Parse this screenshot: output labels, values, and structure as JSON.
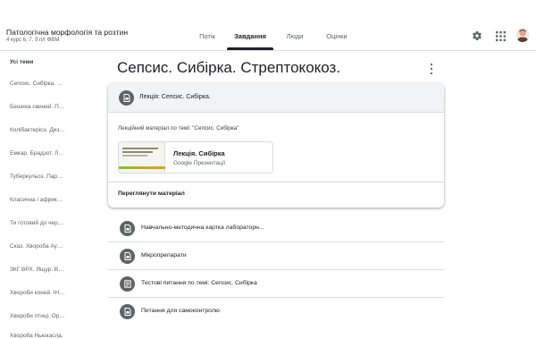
{
  "course": {
    "title": "Патологічна морфологія та розтин",
    "subtitle": "4 курс 6, 7, 9 п/г ФВМ"
  },
  "tabs": [
    {
      "label": "Потік",
      "active": false
    },
    {
      "label": "Завдання",
      "active": true
    },
    {
      "label": "Люди",
      "active": false
    },
    {
      "label": "Оцінки",
      "active": false
    }
  ],
  "header_icons": [
    "gear-icon",
    "apps-grid-icon",
    "avatar"
  ],
  "sidebar": {
    "heading": "Усі теми",
    "items": [
      "Сепсис. Сибірка. Стрептококоз.",
      "Бешиха свиней. Пастерельоз.",
      "Колібактеріоз. Дизентерія свиней.",
      "Емкар. Брадзот. Лептоспіроз.",
      "Туберкульоз. Паратуберкульоз.",
      "Класична і африканська чума свиней.",
      "Ти готовий до чергового заняття?",
      "Сказ. Хвороба Ауєскі.",
      "ЗКГ ВРХ. Ящур. Віспа.",
      "Хвороби коней. ІНАН.",
      "Хвороби птиці. Орнітоз.",
      "Хвороба Ньюкасла."
    ]
  },
  "topic": {
    "title": "Сепсис. Сибірка. Стрептококоз."
  },
  "expanded_card": {
    "title": "Лекція: Сепсис. Сибірка.",
    "description": "Лекційний матеріал по темі: \"Сепсис. Сибірка\"",
    "attachment": {
      "title": "Лекція. Сибірка",
      "type": "Google Презентації"
    },
    "view_label": "Переглянути матеріал"
  },
  "items": [
    {
      "label": "Навчально-методична картка лабораторн...",
      "icon": "material-icon"
    },
    {
      "label": "Мікропрепарати",
      "icon": "material-icon"
    },
    {
      "label": "Тестові питання по темі: Сепсис. Сибірка",
      "icon": "assignment-icon"
    },
    {
      "label": "Питання для самоконтролю",
      "icon": "material-icon"
    }
  ],
  "colors": {
    "icon_circle": "#5f6368",
    "active_tab": "#202124",
    "card_header": "#f1f3f4",
    "divider": "#dadce0"
  }
}
